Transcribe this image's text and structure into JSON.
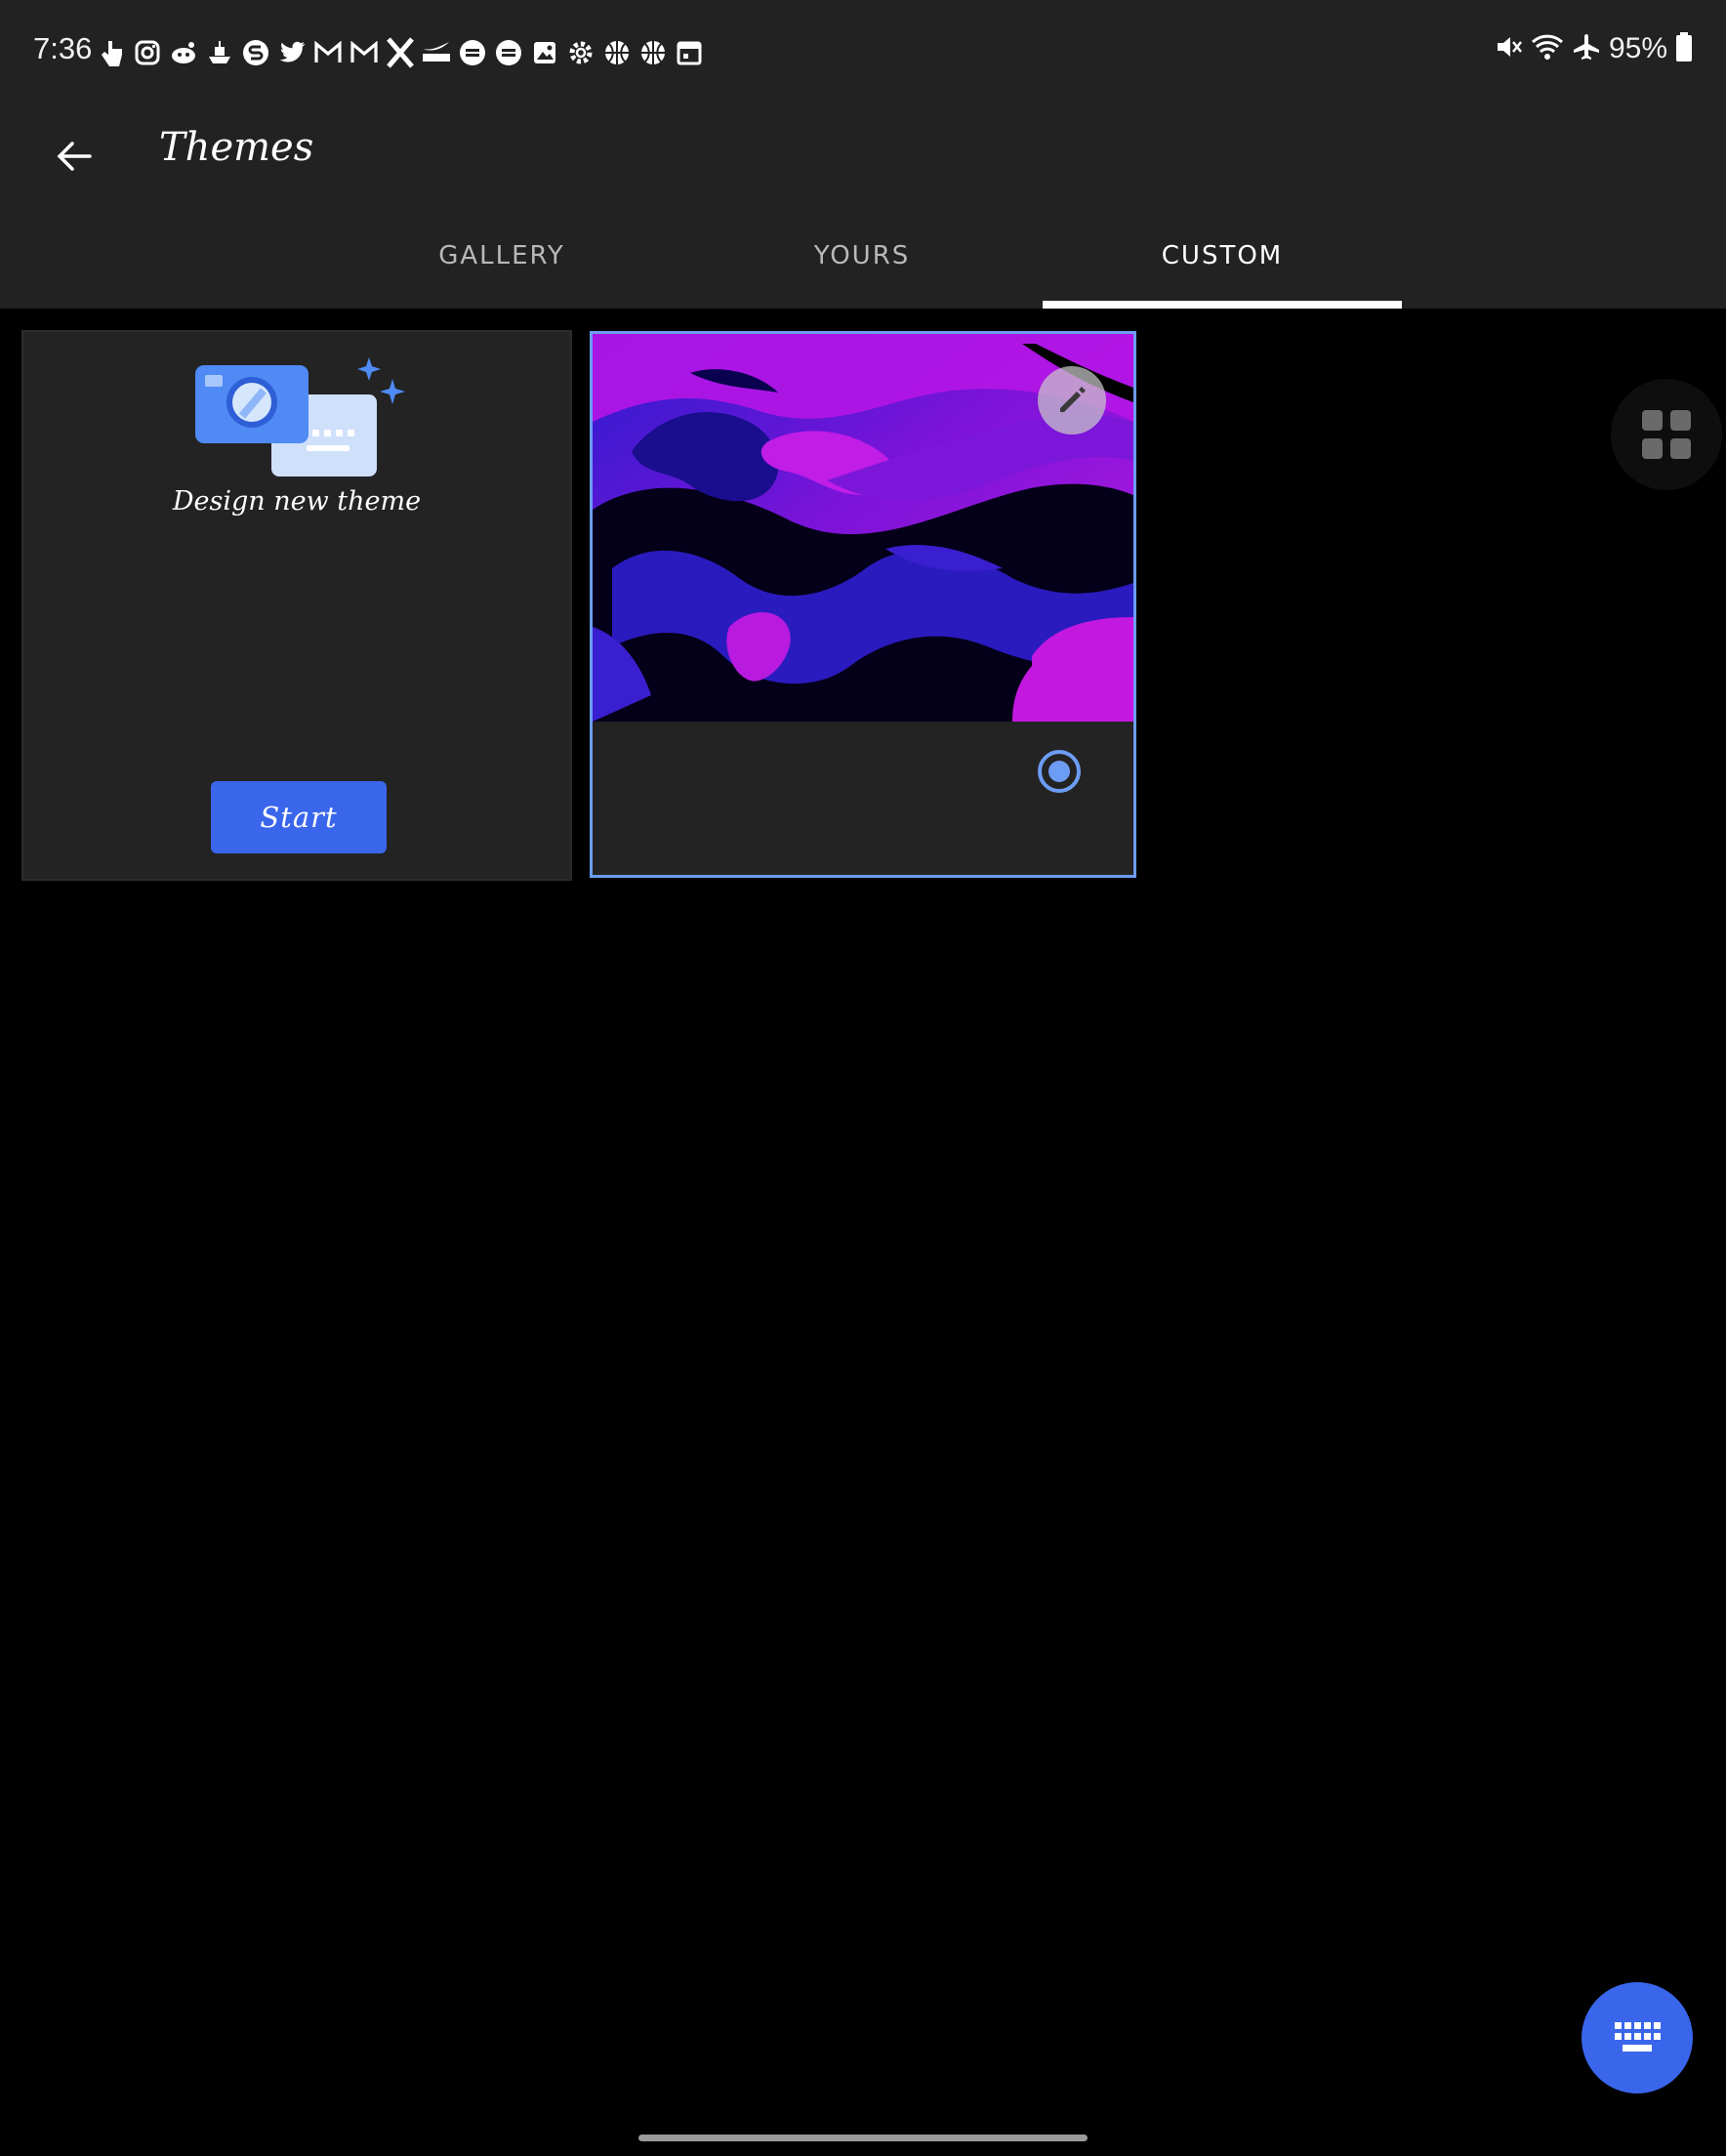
{
  "status_bar": {
    "time": "7:36",
    "battery": "95%",
    "notification_icons": [
      "touch-icon",
      "instagram-icon",
      "reddit-icon",
      "ship-icon",
      "app-s-icon",
      "twitter-icon",
      "gmail-icon",
      "gmail-icon",
      "x-icon",
      "snkrs-icon",
      "footlocker-icon",
      "footlocker-icon",
      "gallery-icon",
      "settings-icon",
      "basketball-icon",
      "basketball-icon",
      "calendar-icon"
    ],
    "system_icons": [
      "mute-icon",
      "wifi-icon",
      "airplane-icon",
      "battery-icon"
    ]
  },
  "toolbar": {
    "title": "Themes"
  },
  "tabs": [
    {
      "label": "GALLERY",
      "active": false
    },
    {
      "label": "YOURS",
      "active": false
    },
    {
      "label": "CUSTOM",
      "active": true
    }
  ],
  "new_theme_card": {
    "label": "Design new theme",
    "start_label": "Start"
  },
  "custom_theme_card": {
    "selected": true
  },
  "colors": {
    "accent": "#3a66ec",
    "selection": "#6d9cf5",
    "surface": "#222222",
    "background": "#000000"
  }
}
